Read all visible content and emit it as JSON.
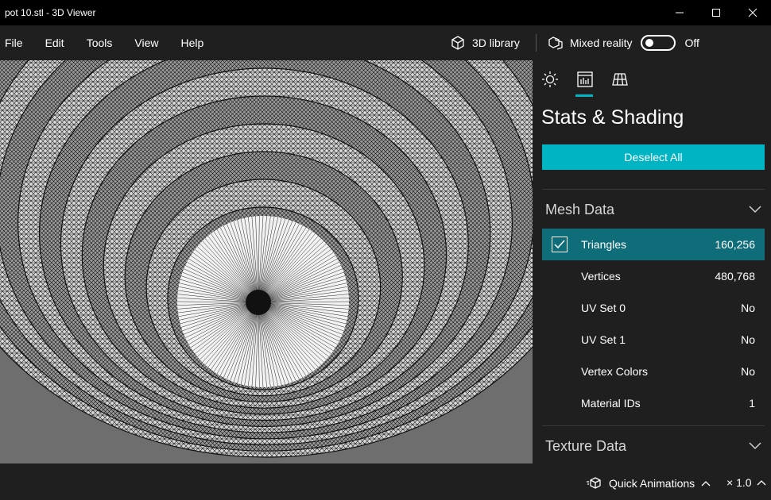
{
  "window": {
    "title": "pot 10.stl - 3D Viewer"
  },
  "menu": {
    "items": [
      "File",
      "Edit",
      "Tools",
      "View",
      "Help"
    ],
    "library_label": "3D library",
    "mixed_reality_label": "Mixed reality",
    "toggle_state": "Off"
  },
  "panel": {
    "tabs": [
      {
        "icon": "lighting-icon",
        "active": false
      },
      {
        "icon": "stats-icon",
        "active": true
      },
      {
        "icon": "grid-icon",
        "active": false
      }
    ],
    "title": "Stats & Shading",
    "deselect_label": "Deselect All",
    "mesh_section": "Mesh Data",
    "mesh_rows": [
      {
        "label": "Triangles",
        "value": "160,256",
        "selected": true
      },
      {
        "label": "Vertices",
        "value": "480,768",
        "selected": false
      },
      {
        "label": "UV Set 0",
        "value": "No",
        "selected": false
      },
      {
        "label": "UV Set 1",
        "value": "No",
        "selected": false
      },
      {
        "label": "Vertex Colors",
        "value": "No",
        "selected": false
      },
      {
        "label": "Material IDs",
        "value": "1",
        "selected": false
      }
    ],
    "texture_section": "Texture Data"
  },
  "status": {
    "quick_animations_label": "Quick Animations",
    "speed_label": "× 1.0"
  },
  "colors": {
    "accent": "#00b4c4",
    "selected_row": "#0e6d79",
    "background": "#1f1f1f",
    "viewport": "#6e6e6e"
  }
}
